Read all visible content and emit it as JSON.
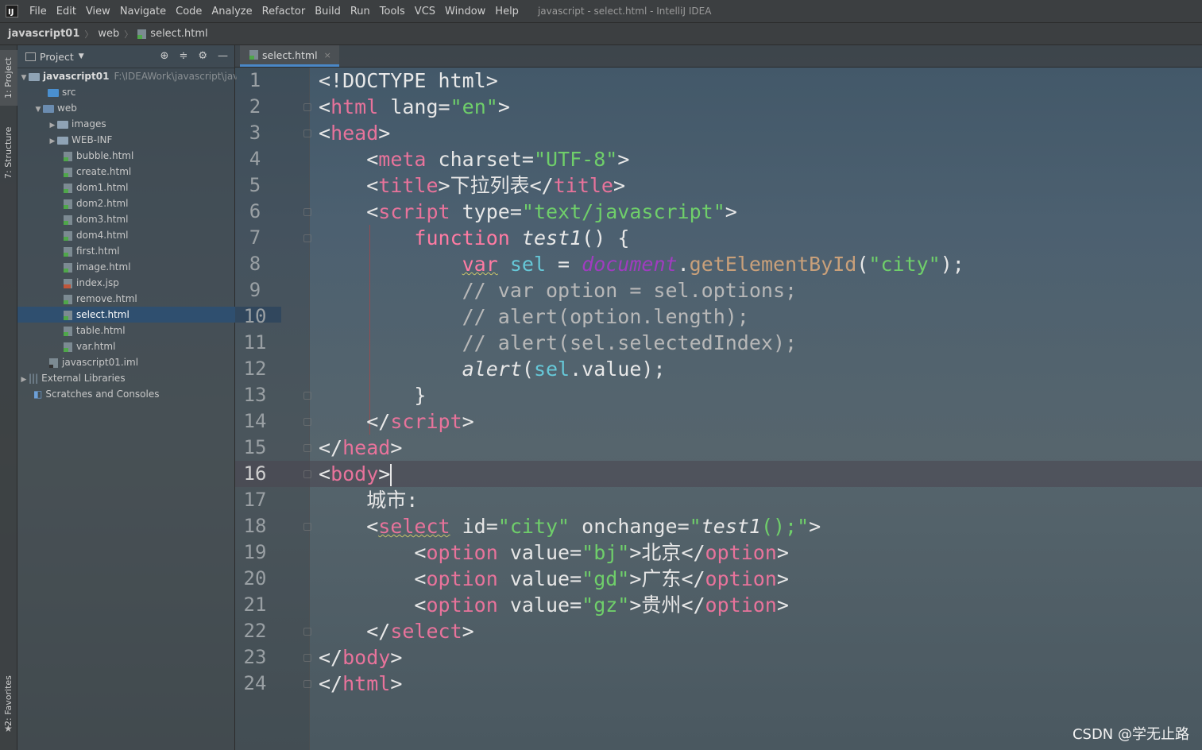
{
  "menubar": {
    "logo": "IJ",
    "items": [
      "File",
      "Edit",
      "View",
      "Navigate",
      "Code",
      "Analyze",
      "Refactor",
      "Build",
      "Run",
      "Tools",
      "VCS",
      "Window",
      "Help"
    ],
    "window_title": "javascript - select.html - IntelliJ IDEA"
  },
  "breadcrumb": {
    "project": "javascript01",
    "folder": "web",
    "file": "select.html"
  },
  "toolstrip": {
    "project_tab": "1: Project",
    "structure_tab": "7: Structure",
    "favorites_tab": "2: Favorites"
  },
  "sidebar": {
    "title": "Project",
    "root": {
      "name": "javascript01",
      "path": "F:\\IDEAWork\\javascript\\jav"
    },
    "items": [
      {
        "label": "src"
      },
      {
        "label": "web"
      },
      {
        "label": "images"
      },
      {
        "label": "WEB-INF"
      },
      {
        "label": "bubble.html"
      },
      {
        "label": "create.html"
      },
      {
        "label": "dom1.html"
      },
      {
        "label": "dom2.html"
      },
      {
        "label": "dom3.html"
      },
      {
        "label": "dom4.html"
      },
      {
        "label": "first.html"
      },
      {
        "label": "image.html"
      },
      {
        "label": "index.jsp"
      },
      {
        "label": "remove.html"
      },
      {
        "label": "select.html"
      },
      {
        "label": "table.html"
      },
      {
        "label": "var.html"
      },
      {
        "label": "javascript01.iml"
      },
      {
        "label": "External Libraries"
      },
      {
        "label": "Scratches and Consoles"
      }
    ]
  },
  "editor": {
    "tab_label": "select.html",
    "current_line": 16,
    "line_numbers": [
      "1",
      "2",
      "3",
      "4",
      "5",
      "6",
      "7",
      "8",
      "9",
      "10",
      "11",
      "12",
      "13",
      "14",
      "15",
      "16",
      "17",
      "18",
      "19",
      "20",
      "21",
      "22",
      "23",
      "24"
    ],
    "lines": [
      [
        [
          "p",
          "<!DOCTYPE html>"
        ]
      ],
      [
        [
          "p",
          "<"
        ],
        [
          "tag",
          "html"
        ],
        [
          "attr",
          " lang="
        ],
        [
          "val",
          "\"en\""
        ],
        [
          "p",
          ">"
        ]
      ],
      [
        [
          "p",
          "<"
        ],
        [
          "tag",
          "head"
        ],
        [
          "p",
          ">"
        ]
      ],
      [
        [
          "p",
          "    <"
        ],
        [
          "tag",
          "meta"
        ],
        [
          "attr",
          " charset="
        ],
        [
          "val",
          "\"UTF-8\""
        ],
        [
          "p",
          ">"
        ]
      ],
      [
        [
          "p",
          "    <"
        ],
        [
          "tag",
          "title"
        ],
        [
          "p",
          ">"
        ],
        [
          "text",
          "下拉列表"
        ],
        [
          "p",
          "</"
        ],
        [
          "tag",
          "title"
        ],
        [
          "p",
          ">"
        ]
      ],
      [
        [
          "p",
          "    <"
        ],
        [
          "tag",
          "script"
        ],
        [
          "attr",
          " type="
        ],
        [
          "val",
          "\"text/javascript\""
        ],
        [
          "p",
          ">"
        ]
      ],
      [
        [
          "p",
          "        "
        ],
        [
          "kw",
          "function"
        ],
        [
          "p",
          " "
        ],
        [
          "fn",
          "test1"
        ],
        [
          "p",
          "() {"
        ]
      ],
      [
        [
          "p",
          "            "
        ],
        [
          "kwsq",
          "var"
        ],
        [
          "p",
          " "
        ],
        [
          "var",
          "sel"
        ],
        [
          "p",
          " = "
        ],
        [
          "doc",
          "document"
        ],
        [
          "p",
          "."
        ],
        [
          "method",
          "getElementById"
        ],
        [
          "p",
          "("
        ],
        [
          "val",
          "\"city\""
        ],
        [
          "p",
          ");"
        ]
      ],
      [
        [
          "c",
          "            // var option = sel.options;"
        ]
      ],
      [
        [
          "c",
          "            // alert(option.length);"
        ]
      ],
      [
        [
          "c",
          "            // alert(sel.selectedIndex);"
        ]
      ],
      [
        [
          "p",
          "            "
        ],
        [
          "fn",
          "alert"
        ],
        [
          "p",
          "("
        ],
        [
          "var",
          "sel"
        ],
        [
          "p",
          ".value);"
        ]
      ],
      [
        [
          "p",
          "        }"
        ]
      ],
      [
        [
          "p",
          "    </"
        ],
        [
          "tag",
          "script"
        ],
        [
          "p",
          ">"
        ]
      ],
      [
        [
          "p",
          "</"
        ],
        [
          "tag",
          "head"
        ],
        [
          "p",
          ">"
        ]
      ],
      [
        [
          "p",
          "<"
        ],
        [
          "tag",
          "body"
        ],
        [
          "p",
          ">"
        ],
        [
          "caret",
          ""
        ]
      ],
      [
        [
          "p",
          "    "
        ],
        [
          "text",
          "城市:"
        ]
      ],
      [
        [
          "p",
          "    <"
        ],
        [
          "tagsq",
          "select"
        ],
        [
          "attr",
          " id="
        ],
        [
          "val",
          "\"city\""
        ],
        [
          "attr",
          " onchange="
        ],
        [
          "val",
          "\""
        ],
        [
          "fn",
          "test1"
        ],
        [
          "val",
          "();\""
        ],
        [
          "p",
          ">"
        ]
      ],
      [
        [
          "p",
          "        <"
        ],
        [
          "tag",
          "option"
        ],
        [
          "attr",
          " value="
        ],
        [
          "val",
          "\"bj\""
        ],
        [
          "p",
          ">"
        ],
        [
          "text",
          "北京"
        ],
        [
          "p",
          "</"
        ],
        [
          "tag",
          "option"
        ],
        [
          "p",
          ">"
        ]
      ],
      [
        [
          "p",
          "        <"
        ],
        [
          "tag",
          "option"
        ],
        [
          "attr",
          " value="
        ],
        [
          "val",
          "\"gd\""
        ],
        [
          "p",
          ">"
        ],
        [
          "text",
          "广东"
        ],
        [
          "p",
          "</"
        ],
        [
          "tag",
          "option"
        ],
        [
          "p",
          ">"
        ]
      ],
      [
        [
          "p",
          "        <"
        ],
        [
          "tag",
          "option"
        ],
        [
          "attr",
          " value="
        ],
        [
          "val",
          "\"gz\""
        ],
        [
          "p",
          ">"
        ],
        [
          "text",
          "贵州"
        ],
        [
          "p",
          "</"
        ],
        [
          "tag",
          "option"
        ],
        [
          "p",
          ">"
        ]
      ],
      [
        [
          "p",
          "    </"
        ],
        [
          "tag",
          "select"
        ],
        [
          "p",
          ">"
        ]
      ],
      [
        [
          "p",
          "</"
        ],
        [
          "tag",
          "body"
        ],
        [
          "p",
          ">"
        ]
      ],
      [
        [
          "p",
          "</"
        ],
        [
          "tag",
          "html"
        ],
        [
          "p",
          ">"
        ]
      ]
    ]
  },
  "watermark": "CSDN @学无止路",
  "colors": {
    "selection": "#2f4f6f",
    "tag": "#e8739b",
    "string": "#6fcf6a",
    "keyword": "#ff7ba3",
    "variable": "#66c8d8",
    "document": "#a03cc0",
    "method": "#c9a07a"
  }
}
